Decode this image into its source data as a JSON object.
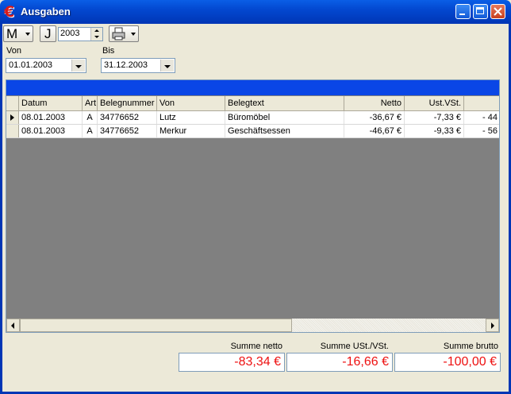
{
  "window": {
    "title": "Ausgaben",
    "icon": "euro-icon"
  },
  "toolbar": {
    "month_label": "M",
    "year_label": "J",
    "year_value": "2003",
    "print_icon": "printer-icon"
  },
  "filter": {
    "from_label": "Von",
    "from_value": "01.01.2003",
    "to_label": "Bis",
    "to_value": "31.12.2003"
  },
  "table": {
    "columns": [
      "Datum",
      "Art",
      "Belegnummer",
      "Von",
      "Belegtext",
      "Netto",
      "Ust.VSt.",
      ""
    ],
    "rows": [
      {
        "datum": "08.01.2003",
        "art": "A",
        "belegnummer": "34776652",
        "von": "Lutz",
        "belegtext": "Büromöbel",
        "netto": "-36,67 €",
        "ust": "-7,33 €",
        "brutto": "- 44"
      },
      {
        "datum": "08.01.2003",
        "art": "A",
        "belegnummer": "34776652",
        "von": "Merkur",
        "belegtext": "Geschäftsessen",
        "netto": "-46,67 €",
        "ust": "-9,33 €",
        "brutto": "- 56"
      }
    ]
  },
  "summary": {
    "netto_label": "Summe netto",
    "netto_value": "-83,34 €",
    "ust_label": "Summe USt./VSt.",
    "ust_value": "-16,66 €",
    "brutto_label": "Summe brutto",
    "brutto_value": "-100,00 €"
  },
  "colors": {
    "selection_bar": "#0a46e6",
    "negative": "#e11111",
    "euro_icon": "#d81a1a"
  }
}
